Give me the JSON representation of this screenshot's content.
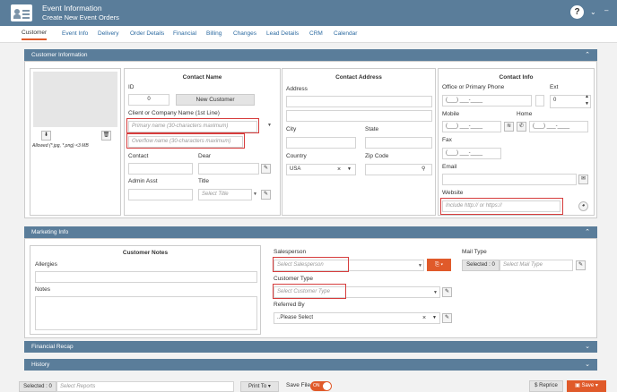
{
  "window": {
    "title": "Event Information",
    "subtitle": "Create New Event Orders",
    "help": "?"
  },
  "tabs": [
    "Customer",
    "Event Info",
    "Delivery",
    "Order Details",
    "Financial",
    "Billing",
    "Changes",
    "Lead Details",
    "CRM",
    "Calendar"
  ],
  "customer_info": {
    "header": "Customer Information",
    "photo_hint": "Allowed (*.jpg, *.png) <3 MB",
    "contact_name": {
      "title": "Contact Name",
      "id_label": "ID",
      "id_value": "0",
      "new_customer": "New Customer",
      "company_label": "Client or Company Name (1st Line)",
      "primary_placeholder": "Primary name (30-characters maximum)",
      "overflow_placeholder": "Overflow name (30-characters maximum)",
      "contact_label": "Contact",
      "dear_label": "Dear",
      "admin_label": "Admin Asst",
      "title_label": "Title",
      "title_placeholder": "Select Title"
    },
    "contact_address": {
      "title": "Contact Address",
      "address_label": "Address",
      "city_label": "City",
      "state_label": "State",
      "country_label": "Country",
      "country_value": "USA",
      "zip_label": "Zip Code"
    },
    "contact_info": {
      "title": "Contact Info",
      "office_label": "Office or Primary Phone",
      "ext_label": "Ext",
      "office_mask": "(___) ___-____",
      "ext_value": "0",
      "mobile_label": "Mobile",
      "home_label": "Home",
      "mobile_mask": "(___) ___-____",
      "home_mask": "(___) ___-____",
      "fax_label": "Fax",
      "fax_mask": "(___) ___-____",
      "email_label": "Email",
      "website_label": "Website",
      "website_placeholder": "Include http:// or https://"
    }
  },
  "marketing": {
    "header": "Marketing Info",
    "notes_title": "Customer Notes",
    "allergies_label": "Allergies",
    "notes_label": "Notes",
    "salesperson_label": "Salesperson",
    "salesperson_placeholder": "Select Salesperson",
    "customer_type_label": "Customer Type",
    "customer_type_placeholder": "Select Customer Type",
    "referred_label": "Referred By",
    "referred_value": "..Please Select",
    "mail_type_label": "Mail Type",
    "mail_selected": "Selected : 0",
    "mail_placeholder": "Select Mail Type"
  },
  "financial_recap": {
    "header": "Financial Recap"
  },
  "history": {
    "header": "History"
  },
  "footer": {
    "selected": "Selected : 0",
    "reports_placeholder": "Select Reports",
    "print_to": "Print To",
    "save_file": "Save File",
    "toggle": "ON",
    "reprice": "Reprice",
    "save": "Save"
  },
  "colors": {
    "header_bg": "#5a7d9a",
    "accent": "#e05a2a",
    "highlight_box": "#d63c3c"
  }
}
